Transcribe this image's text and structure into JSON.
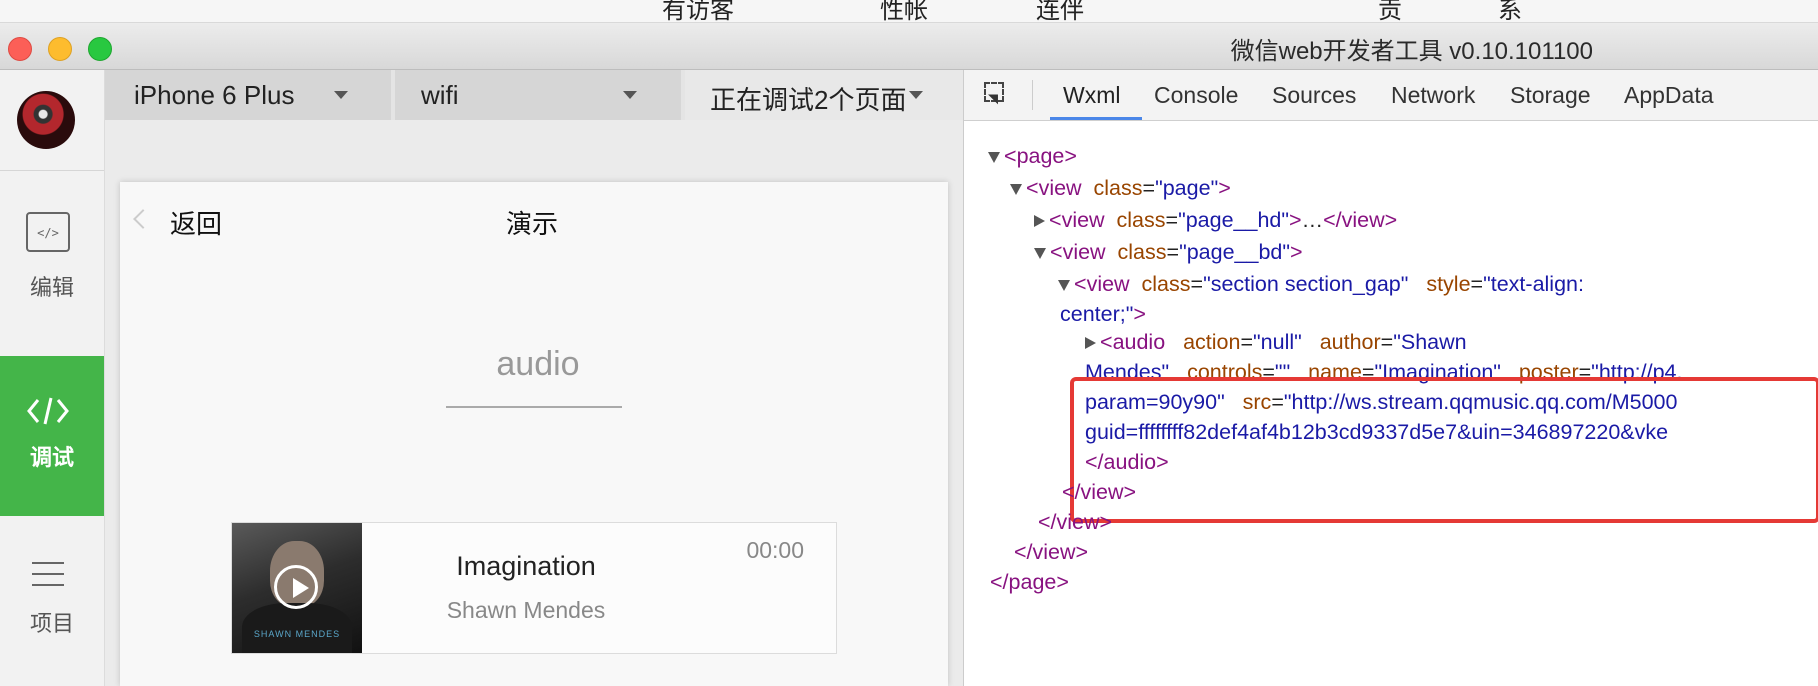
{
  "window": {
    "title": "微信web开发者工具 v0.10.101100",
    "menubar_fragments": [
      "有访客",
      "性帐",
      "连伴",
      "贡",
      "系"
    ]
  },
  "sidebar": {
    "items": [
      {
        "label": "编辑",
        "icon": "code-editor-icon"
      },
      {
        "label": "调试",
        "icon": "code-brackets-icon",
        "active": true
      },
      {
        "label": "项目",
        "icon": "menu-lines-icon"
      }
    ]
  },
  "device_toolbar": {
    "device": "iPhone 6 Plus",
    "network": "wifi",
    "debug_pages": "正在调试2个页面"
  },
  "simulator": {
    "nav_back": "返回",
    "nav_title": "演示",
    "section_title": "audio",
    "player": {
      "name": "Imagination",
      "author": "Shawn Mendes",
      "time": "00:00",
      "cover_text": "SHAWN MENDES"
    }
  },
  "devtools": {
    "tabs": [
      "Wxml",
      "Console",
      "Sources",
      "Network",
      "Storage",
      "AppData"
    ],
    "active_tab": "Wxml",
    "lines": {
      "l1": "page",
      "l2_tag": "view",
      "l2_attr": "class",
      "l2_val": "page",
      "l3_tag": "view",
      "l3_attr": "class",
      "l3_val": "page__hd",
      "l3_rest": "…",
      "l4_tag": "view",
      "l4_attr": "class",
      "l4_val": "page__bd",
      "l5_tag": "view",
      "l5_attr1": "class",
      "l5_val1": "section section_gap",
      "l5_attr2": "style",
      "l5_val2": "text-align:",
      "l5b": "center;",
      "a1_tag": "audio",
      "a1_attr1": "action",
      "a1_val1": "null",
      "a1_attr2": "author",
      "a1_val2a": "Shawn",
      "a2_val2b": "Mendes",
      "a2_attr3": "controls",
      "a2_val3": "",
      "a2_attr4": "name",
      "a2_val4": "Imagination",
      "a2_attr5": "poster",
      "a2_val5": "http://p4.",
      "a3_val5b": "param=90y90",
      "a3_attr6": "src",
      "a3_val6": "http://ws.stream.qqmusic.qq.com/M5000",
      "a4_val6b": "guid=ffffffff82def4af4b12b3cd9337d5e7&uin=346897220&vke",
      "c_audio": "audio",
      "c_view": "view",
      "c_page": "page"
    }
  },
  "colors": {
    "active_sidebar": "#44b549",
    "highlight_box": "#e53935",
    "tag": "#881280",
    "attr": "#994500",
    "value": "#1a1aa6"
  }
}
